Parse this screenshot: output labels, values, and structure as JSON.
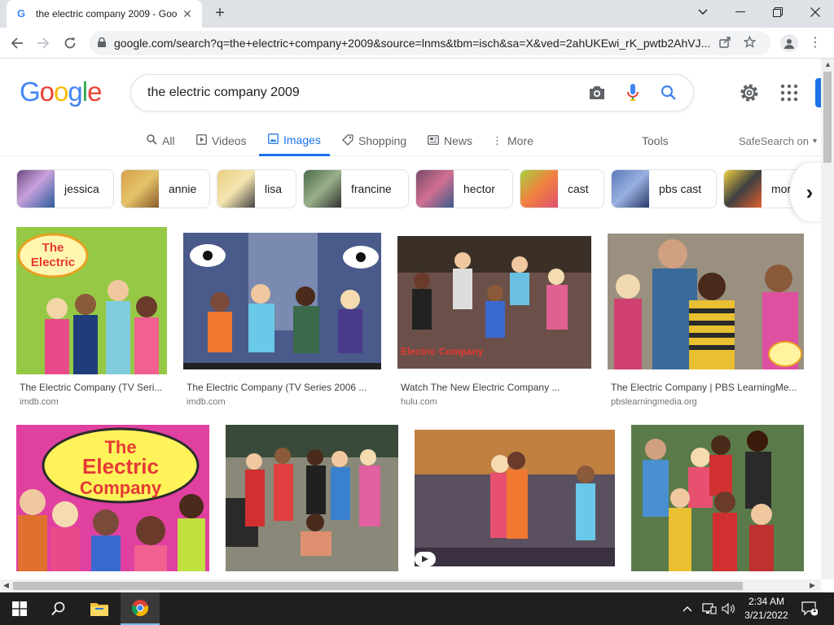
{
  "browser": {
    "tab_title": "the electric company 2009 - Goo",
    "tab_favicon": "G",
    "url": "google.com/search?q=the+electric+company+2009&source=lnms&tbm=isch&sa=X&ved=2ahUKEwi_rK_pwtb2AhVJ..."
  },
  "google": {
    "logo": [
      "G",
      "o",
      "o",
      "g",
      "l",
      "e"
    ],
    "logo_colors": [
      "#4285f4",
      "#ea4335",
      "#fbbc05",
      "#4285f4",
      "#34a853",
      "#ea4335"
    ],
    "query": "the electric company 2009",
    "tabs": [
      {
        "label": "All",
        "icon": "search-icon"
      },
      {
        "label": "Videos",
        "icon": "video-icon"
      },
      {
        "label": "Images",
        "icon": "image-icon",
        "active": true
      },
      {
        "label": "Shopping",
        "icon": "tag-icon"
      },
      {
        "label": "News",
        "icon": "news-icon"
      },
      {
        "label": "More",
        "icon": "more-dots-icon"
      }
    ],
    "tools": "Tools",
    "safesearch": "SafeSearch on",
    "chips": [
      "jessica",
      "annie",
      "lisa",
      "francine",
      "hector",
      "cast",
      "pbs cast",
      "mor"
    ],
    "results": [
      {
        "title": "The Electric Company (TV Seri...",
        "source": "imdb.com"
      },
      {
        "title": "The Electric Company (TV Series 2006 ...",
        "source": "imdb.com"
      },
      {
        "title": "Watch The New Electric Company ...",
        "source": "hulu.com"
      },
      {
        "title": "The Electric Company | PBS LearningMe...",
        "source": "pbslearningmedia.org"
      },
      {
        "title": "",
        "source": ""
      },
      {
        "title": "",
        "source": ""
      },
      {
        "title": "",
        "source": ""
      },
      {
        "title": "",
        "source": ""
      }
    ],
    "image_text": [
      "The Electric Company",
      "Electric Company",
      "The Electric Company",
      "The Electric Company"
    ]
  },
  "taskbar": {
    "time": "2:34 AM",
    "date": "3/21/2022",
    "notification_count": "1"
  },
  "colors": {
    "accent": "#1a73e8",
    "chrome_bg": "#dee1e6",
    "taskbar_bg": "#1f1f1f"
  }
}
